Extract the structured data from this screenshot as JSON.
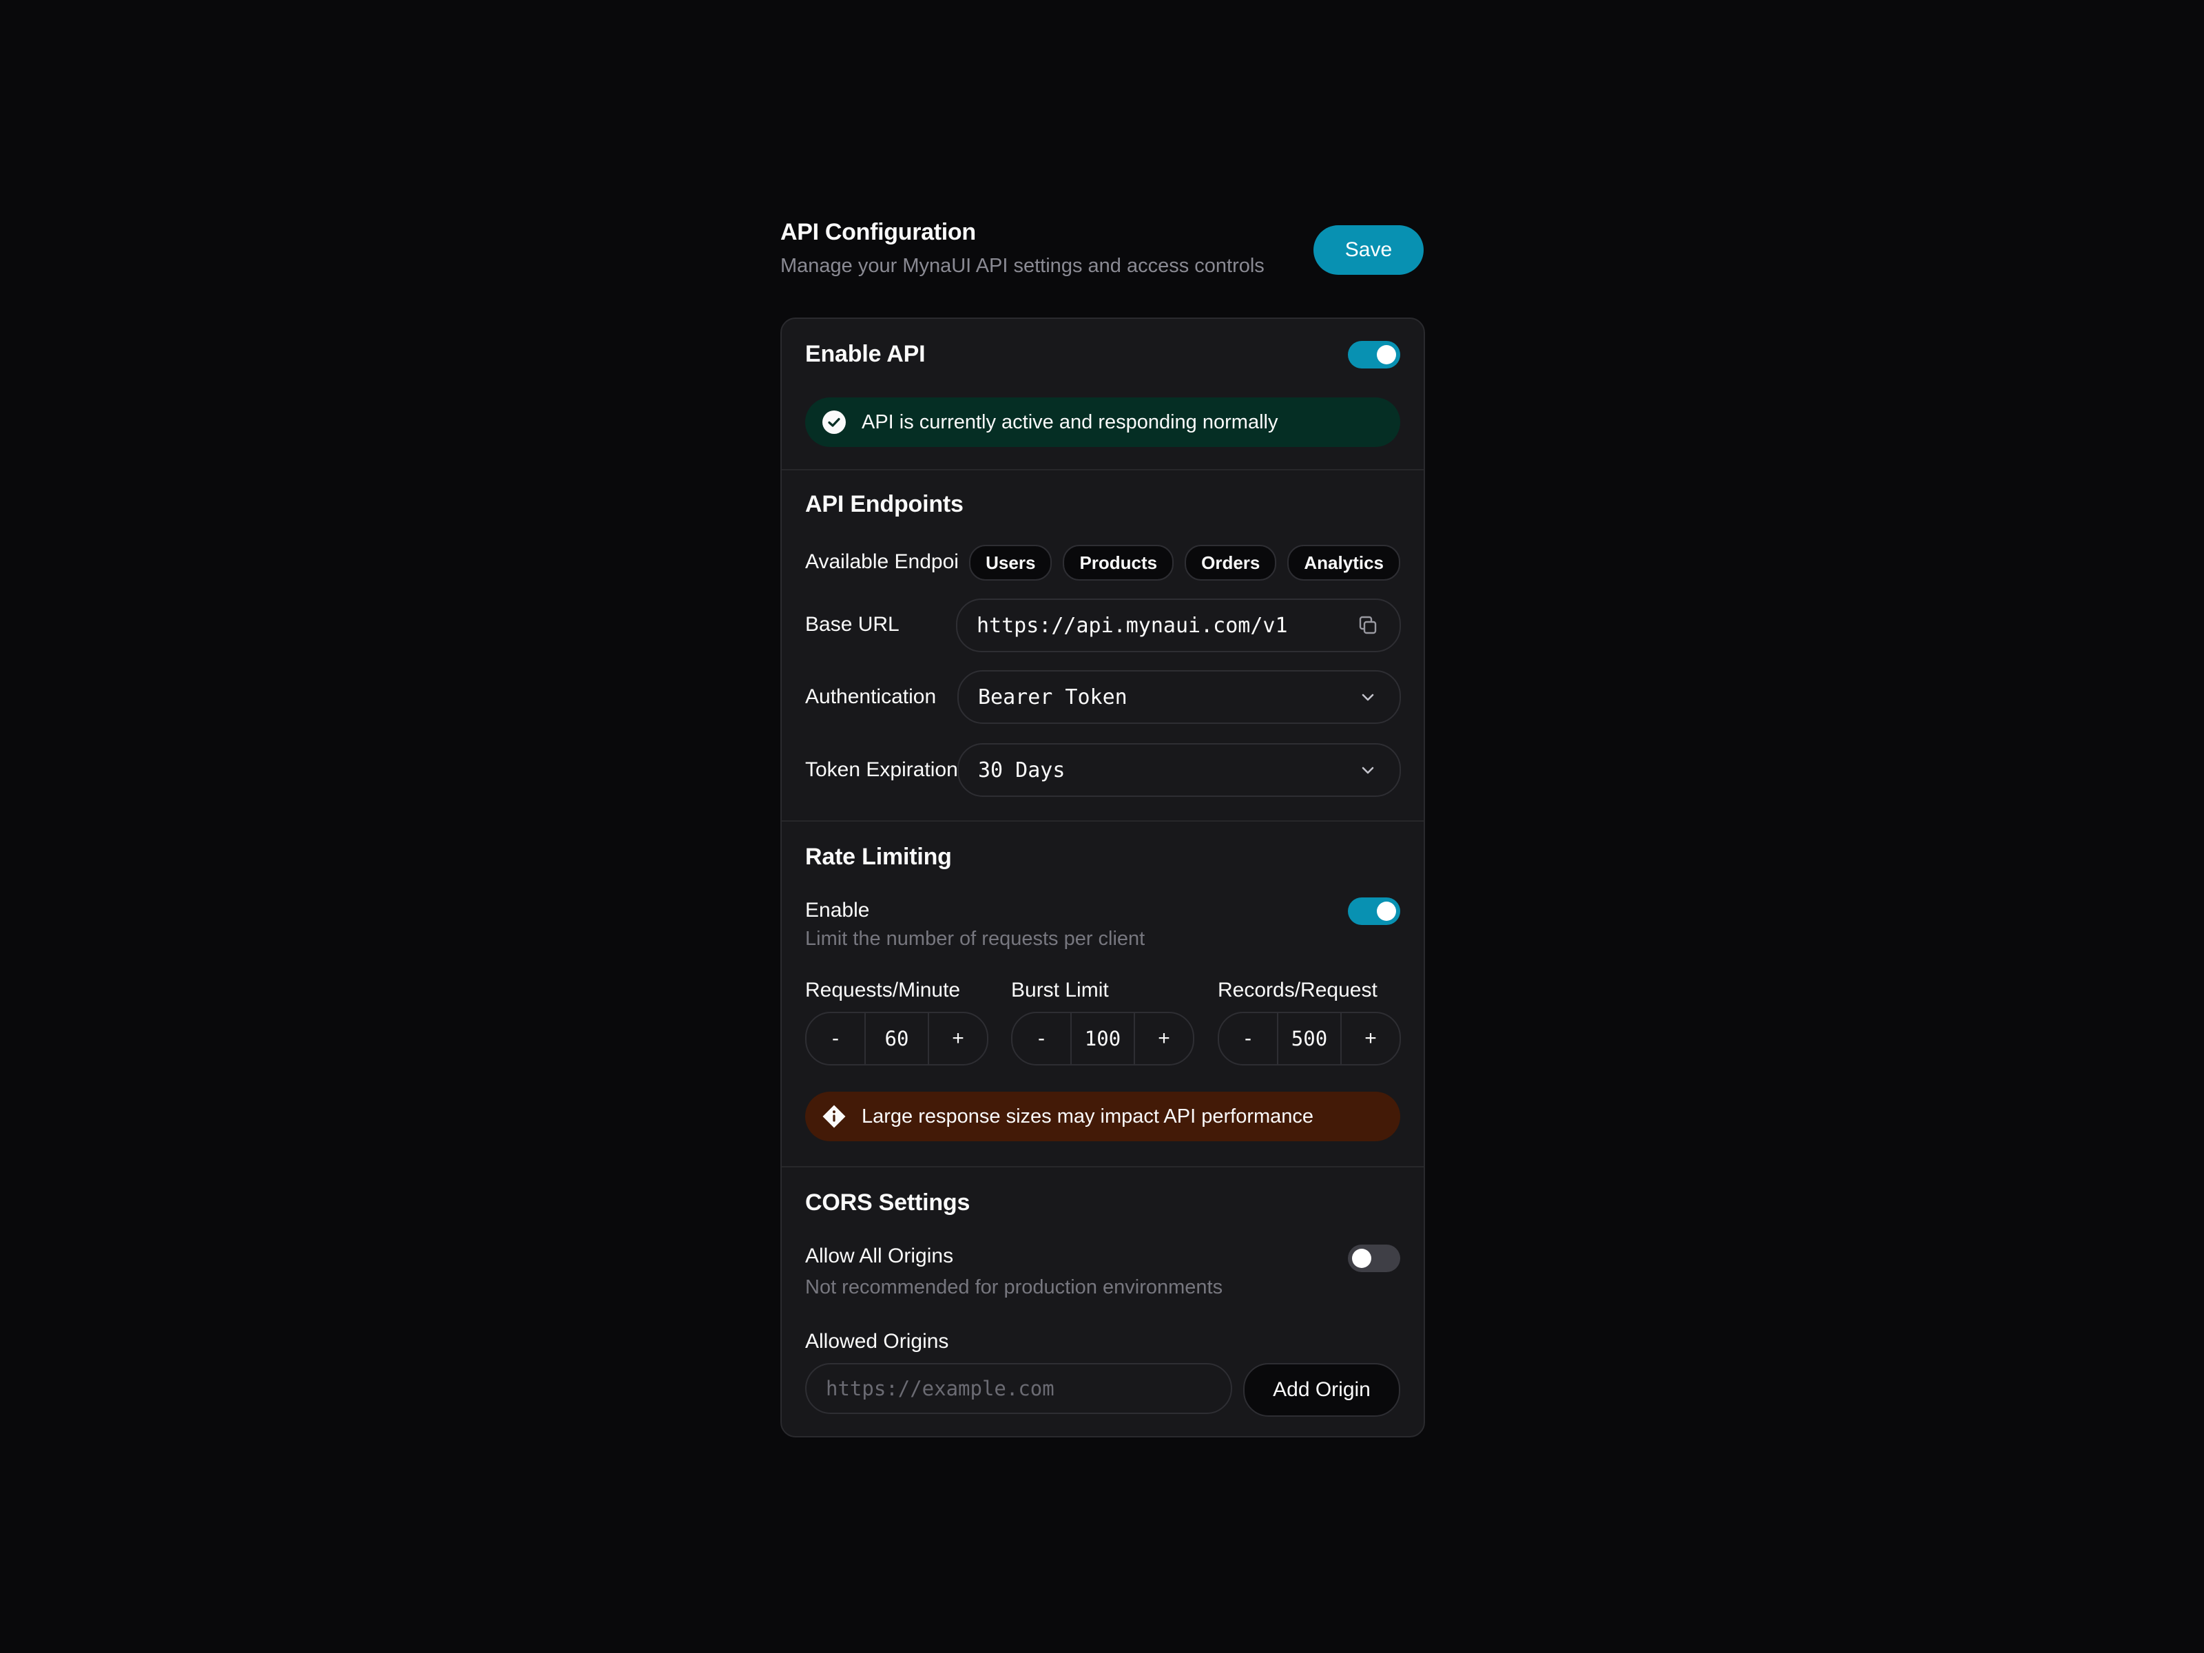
{
  "header": {
    "title": "API Configuration",
    "subtitle": "Manage your MynaUI API settings and access controls",
    "save_label": "Save"
  },
  "enable_api": {
    "title": "Enable API",
    "enabled": true,
    "status_message": "API is currently active and responding normally"
  },
  "endpoints": {
    "title": "API Endpoints",
    "available_label": "Available Endpoints",
    "items": [
      "Users",
      "Products",
      "Orders",
      "Analytics"
    ],
    "base_url_label": "Base URL",
    "base_url": "https://api.mynaui.com/v1",
    "auth_label": "Authentication",
    "auth_value": "Bearer Token",
    "expiration_label": "Token Expiration",
    "expiration_value": "30 Days"
  },
  "rate_limiting": {
    "title": "Rate Limiting",
    "enable_label": "Enable",
    "enable_desc": "Limit the number of requests per client",
    "enabled": true,
    "steppers": [
      {
        "label": "Requests/Minute",
        "value": "60"
      },
      {
        "label": "Burst Limit",
        "value": "100"
      },
      {
        "label": "Records/Request",
        "value": "500"
      }
    ],
    "minus": "-",
    "plus": "+",
    "warning": "Large response sizes may impact API performance"
  },
  "cors": {
    "title": "CORS Settings",
    "allow_all_label": "Allow All Origins",
    "allow_all_desc": "Not recommended for production environments",
    "allow_all_enabled": false,
    "allowed_origins_label": "Allowed Origins",
    "origin_placeholder": "https://example.com",
    "add_label": "Add Origin"
  },
  "colors": {
    "accent": "#0891b2",
    "success_bg": "#052e24",
    "warning_bg": "#431a07",
    "background": "#09090b",
    "card": "#18181b"
  }
}
